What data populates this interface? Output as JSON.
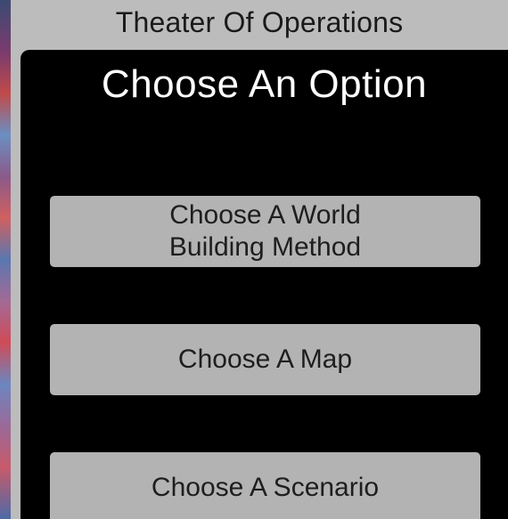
{
  "window": {
    "title": "Theater Of Operations"
  },
  "panel": {
    "heading": "Choose An Option",
    "buttons": {
      "world_building": "Choose A World\nBuilding Method",
      "map": "Choose A Map",
      "scenario": "Choose A Scenario"
    }
  },
  "colors": {
    "title_bar": "#bcbcbc",
    "panel_background": "#000000",
    "button_background": "#b3b3b3",
    "heading_text": "#ffffff",
    "button_text": "#1e1e1e"
  }
}
